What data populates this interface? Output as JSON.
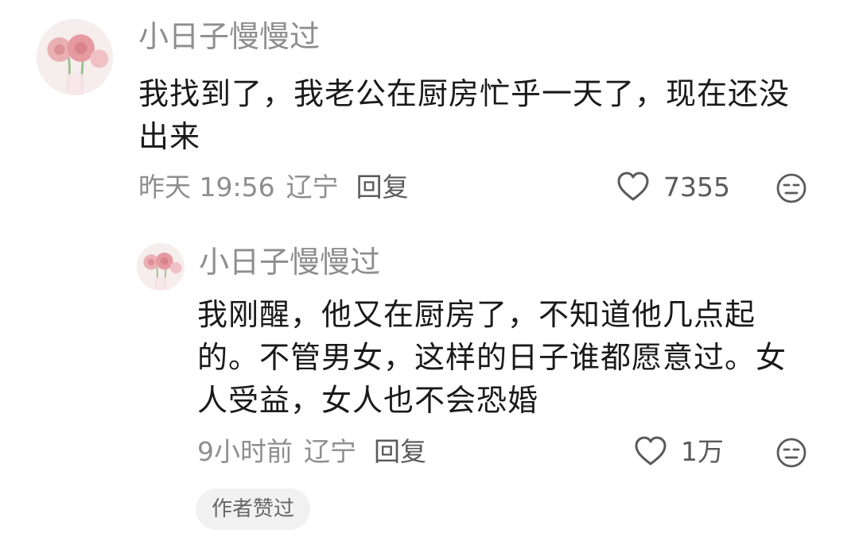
{
  "comment": {
    "username": "小日子慢慢过",
    "text": "我找到了，我老公在厨房忙乎一天了，现在还没出来",
    "time": "昨天 19:56",
    "location": "辽宁",
    "reply_label": "回复",
    "like_count": "7355",
    "icons": {
      "avatar": "pink-flowers-avatar",
      "like": "heart-icon",
      "dislike": "unamused-face-icon"
    }
  },
  "reply": {
    "username": "小日子慢慢过",
    "text": "我刚醒，他又在厨房了，不知道他几点起的。不管男女，这样的日子谁都愿意过。女人受益，女人也不会恐婚",
    "time": "9小时前",
    "location": "辽宁",
    "reply_label": "回复",
    "like_count": "1万",
    "author_badge": "作者赞过",
    "icons": {
      "avatar": "pink-flowers-avatar",
      "like": "heart-icon",
      "dislike": "unamused-face-icon"
    }
  },
  "colors": {
    "username": "#8e8e8e",
    "text": "#1a1a1a",
    "meta": "#8e8e8e",
    "badge_bg": "#f1f1f1"
  }
}
